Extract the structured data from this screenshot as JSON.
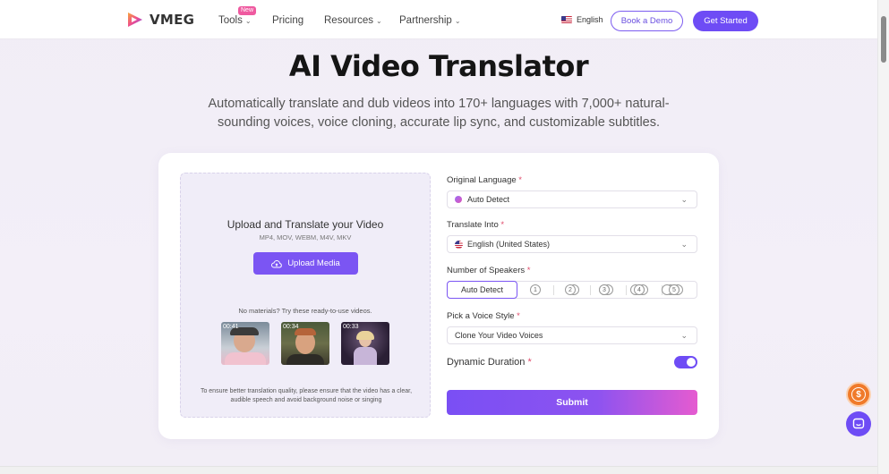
{
  "header": {
    "brand": "VMEG",
    "nav": [
      {
        "label": "Tools",
        "badge": "New",
        "has_dropdown": true
      },
      {
        "label": "Pricing",
        "has_dropdown": false
      },
      {
        "label": "Resources",
        "has_dropdown": true
      },
      {
        "label": "Partnership",
        "has_dropdown": true
      }
    ],
    "language": "English",
    "book_demo": "Book a Demo",
    "get_started": "Get Started"
  },
  "hero": {
    "title": "AI Video Translator",
    "subtitle": "Automatically translate and dub videos into 170+ languages with 7,000+ natural-sounding voices, voice cloning, accurate lip sync, and customizable subtitles."
  },
  "upload": {
    "title": "Upload and Translate your Video",
    "formats": "MP4, MOV, WEBM, M4V, MKV",
    "button": "Upload Media",
    "no_materials": "No materials? Try these ready-to-use videos.",
    "samples": [
      {
        "duration": "00:41"
      },
      {
        "duration": "00:34"
      },
      {
        "duration": "00:33"
      }
    ],
    "note": "To ensure better translation quality, please ensure that the video has a clear, audible speech and avoid background noise or singing"
  },
  "form": {
    "original_language_label": "Original Language",
    "original_language_value": "Auto Detect",
    "translate_into_label": "Translate Into",
    "translate_into_value": "English (United States)",
    "speakers_label": "Number of Speakers",
    "speakers_auto": "Auto Detect",
    "speakers_options": [
      "1",
      "2",
      "3",
      "4",
      "5"
    ],
    "voice_style_label": "Pick a Voice Style",
    "voice_style_value": "Clone Your Video Voices",
    "dynamic_duration_label": "Dynamic Duration",
    "dynamic_duration_on": true,
    "required_mark": "*",
    "submit": "Submit"
  },
  "colors": {
    "accent": "#6e4cf5",
    "required": "#e04a6a",
    "coin": "#f07a2a"
  },
  "icons": [
    "vmeg-logo-icon",
    "chevron-down-icon",
    "us-flag-icon",
    "cloud-upload-icon",
    "sparkle-dot-icon",
    "dollar-coin-icon",
    "chat-icon"
  ]
}
